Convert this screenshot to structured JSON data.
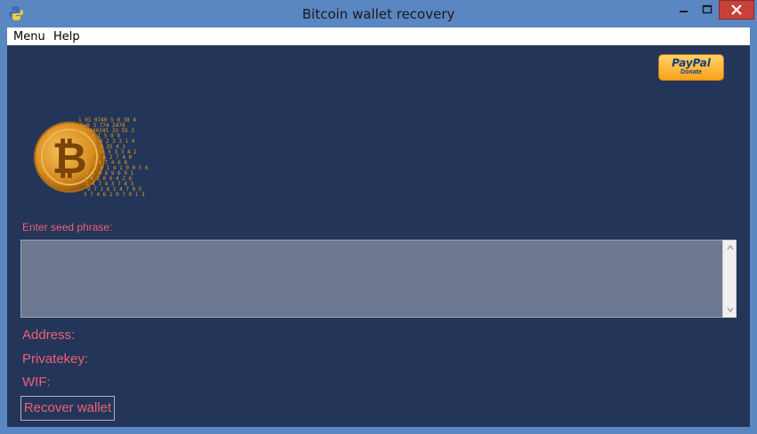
{
  "window": {
    "title": "Bitcoin wallet recovery",
    "icons": {
      "app": "python-icon",
      "minimize": "minimize-icon",
      "maximize": "maximize-icon",
      "close": "close-icon"
    }
  },
  "menubar": {
    "items": [
      {
        "label": "Menu"
      },
      {
        "label": "Help"
      }
    ]
  },
  "donate": {
    "brand": "PayPal",
    "label": "Donate"
  },
  "seed": {
    "label": "Enter seed phrase:",
    "value": ""
  },
  "fields": {
    "address_label": "Address:",
    "privatekey_label": "Privatekey:",
    "wif_label": "WIF:"
  },
  "actions": {
    "recover_label": "Recover wallet"
  },
  "colors": {
    "background": "#233659",
    "accent_text": "#ef5f78",
    "textarea": "#6d7890",
    "coin": "#e09a28"
  }
}
